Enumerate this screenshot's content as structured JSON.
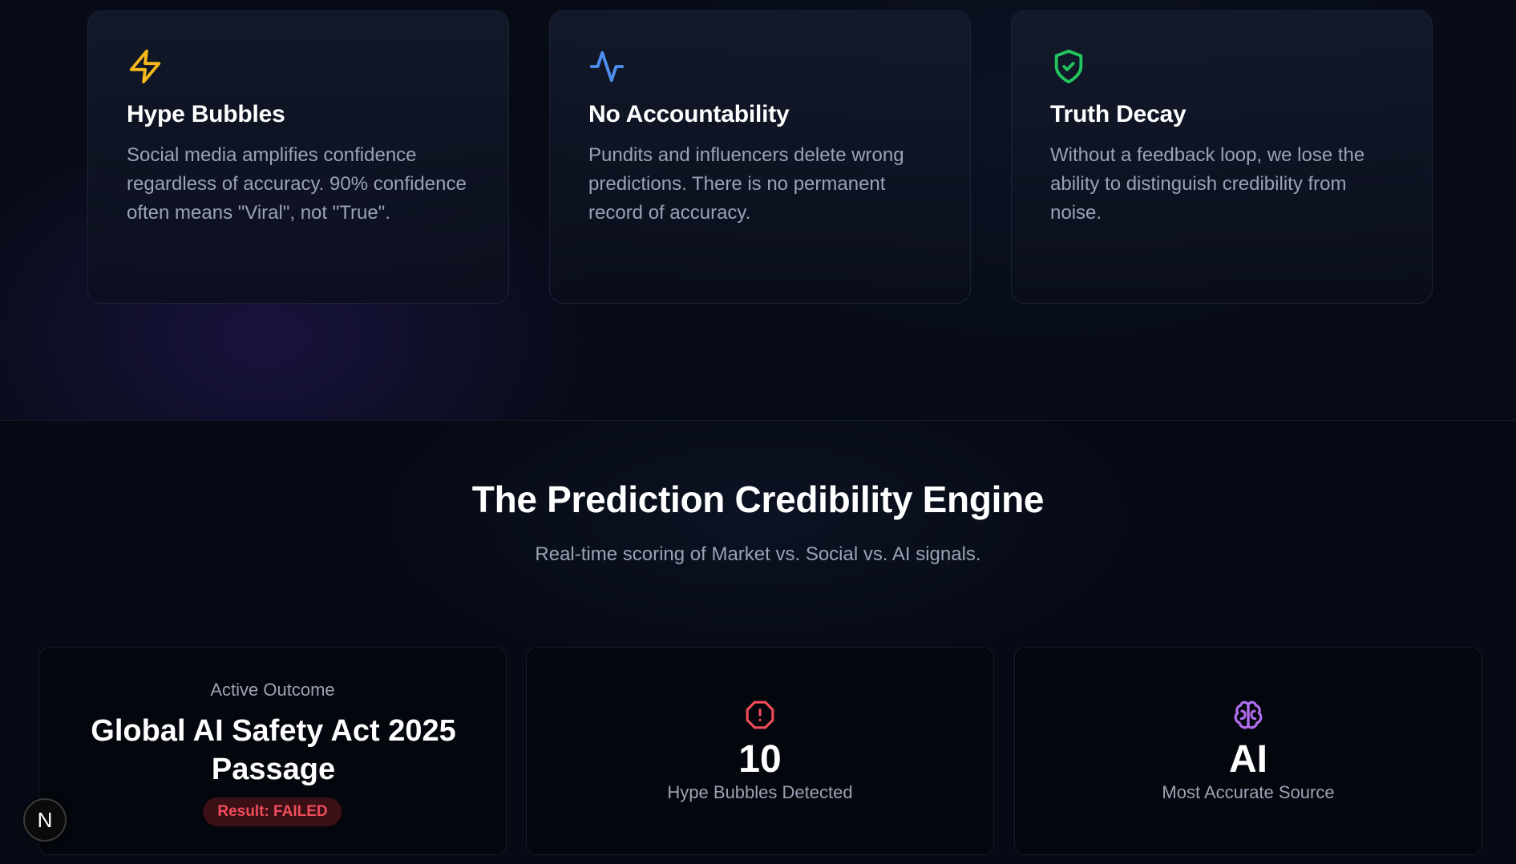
{
  "problems": [
    {
      "icon": "lightning-icon",
      "icon_color": "#f6b91b",
      "title": "Hype Bubbles",
      "description": "Social media amplifies confidence regardless of accuracy. 90% confidence often means \"Viral\", not \"True\"."
    },
    {
      "icon": "activity-pulse-icon",
      "icon_color": "#4c8ff0",
      "title": "No Accountability",
      "description": "Pundits and influencers delete wrong predictions. There is no permanent record of accuracy."
    },
    {
      "icon": "shield-check-icon",
      "icon_color": "#22c55e",
      "title": "Truth Decay",
      "description": "Without a feedback loop, we lose the ability to distinguish credibility from noise."
    }
  ],
  "engine": {
    "title": "The Prediction Credibility Engine",
    "subtitle": "Real-time scoring of Market vs. Social vs. AI signals."
  },
  "stats": {
    "outcome": {
      "eyebrow": "Active Outcome",
      "title": "Global AI Safety Act 2025 Passage",
      "result_badge": "Result: FAILED",
      "badge_color": "#ef4d5a"
    },
    "hype": {
      "icon": "alert-octagon-icon",
      "icon_color": "#ef4d5a",
      "value": "10",
      "label": "Hype Bubbles Detected"
    },
    "source": {
      "icon": "brain-icon",
      "icon_color": "#b36ef0",
      "value": "AI",
      "label": "Most Accurate Source"
    }
  },
  "floating_button": {
    "label": "N"
  }
}
